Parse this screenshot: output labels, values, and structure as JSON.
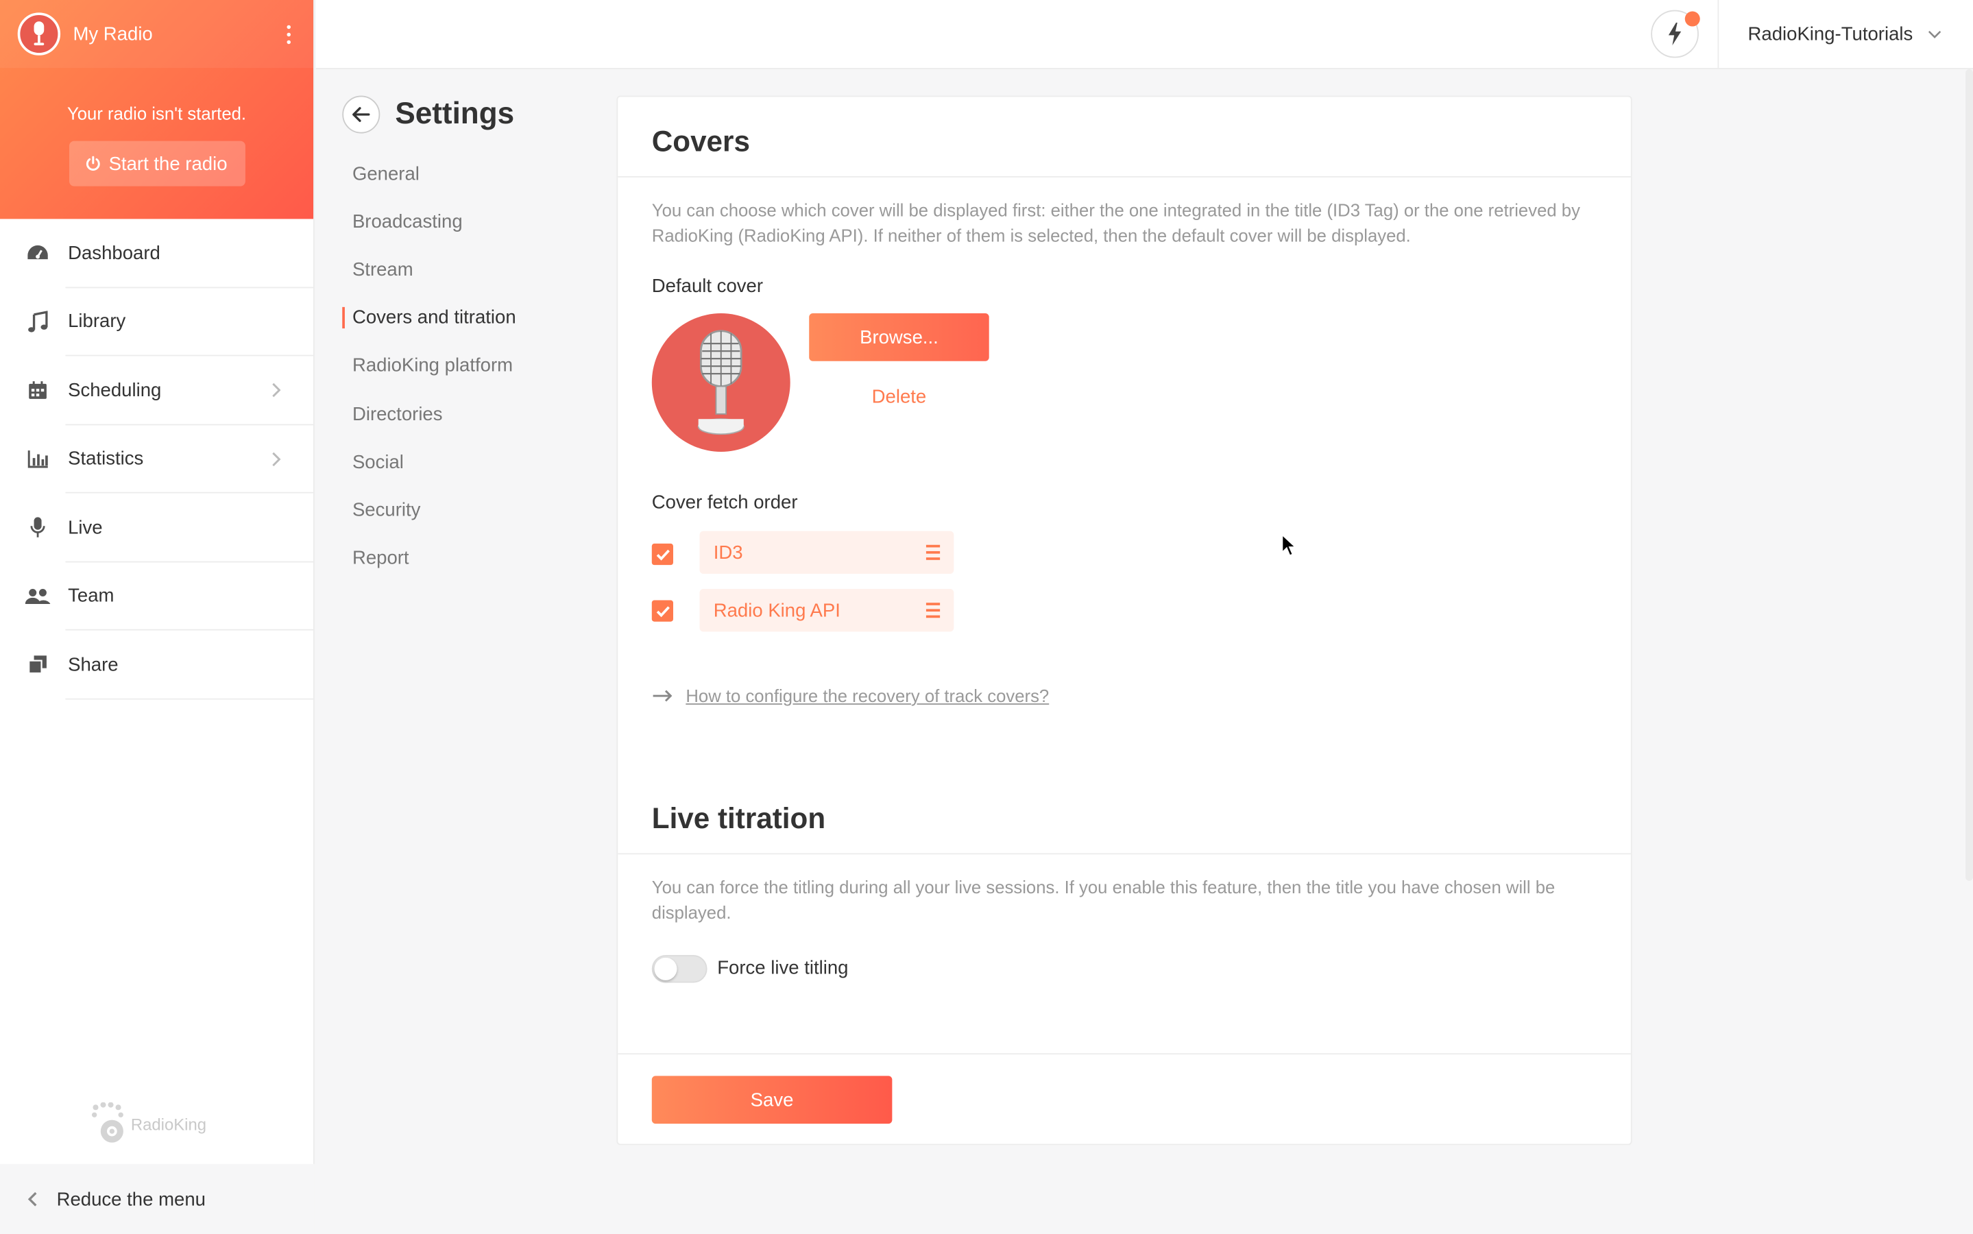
{
  "sidebar": {
    "radio_name": "My Radio",
    "status_text": "Your radio isn't started.",
    "start_label": "Start the radio",
    "nav": [
      {
        "label": "Dashboard",
        "icon": "dashboard-icon"
      },
      {
        "label": "Library",
        "icon": "music-note-icon"
      },
      {
        "label": "Scheduling",
        "icon": "calendar-icon",
        "has_submenu": true
      },
      {
        "label": "Statistics",
        "icon": "bar-chart-icon",
        "has_submenu": true
      },
      {
        "label": "Live",
        "icon": "microphone-icon"
      },
      {
        "label": "Team",
        "icon": "team-icon"
      },
      {
        "label": "Share",
        "icon": "share-icon"
      }
    ],
    "brand": "RadioKing",
    "reduce_label": "Reduce the menu"
  },
  "topbar": {
    "account_name": "RadioKing-Tutorials"
  },
  "settings": {
    "title": "Settings",
    "nav": [
      "General",
      "Broadcasting",
      "Stream",
      "Covers and titration",
      "RadioKing platform",
      "Directories",
      "Social",
      "Security",
      "Report"
    ],
    "active": "Covers and titration"
  },
  "covers": {
    "title": "Covers",
    "description": "You can choose which cover will be displayed first: either the one integrated in the title (ID3 Tag) or the one retrieved by RadioKing (RadioKing API). If neither of them is selected, then the default cover will be displayed.",
    "default_cover_label": "Default cover",
    "browse_label": "Browse...",
    "delete_label": "Delete",
    "fetch_order_label": "Cover fetch order",
    "fetch_order": [
      {
        "label": "ID3",
        "checked": true
      },
      {
        "label": "Radio King API",
        "checked": true
      }
    ],
    "help_link": "How to configure the recovery of track covers?"
  },
  "live_titration": {
    "title": "Live titration",
    "description": "You can force the titling during all your live sessions. If you enable this feature, then the title you have chosen will be displayed.",
    "toggle_label": "Force live titling",
    "toggle_on": false
  },
  "save_label": "Save",
  "colors": {
    "accent": "#ff7a4d",
    "gradient_start": "#ff8a4d",
    "gradient_end": "#ff5a4a"
  }
}
